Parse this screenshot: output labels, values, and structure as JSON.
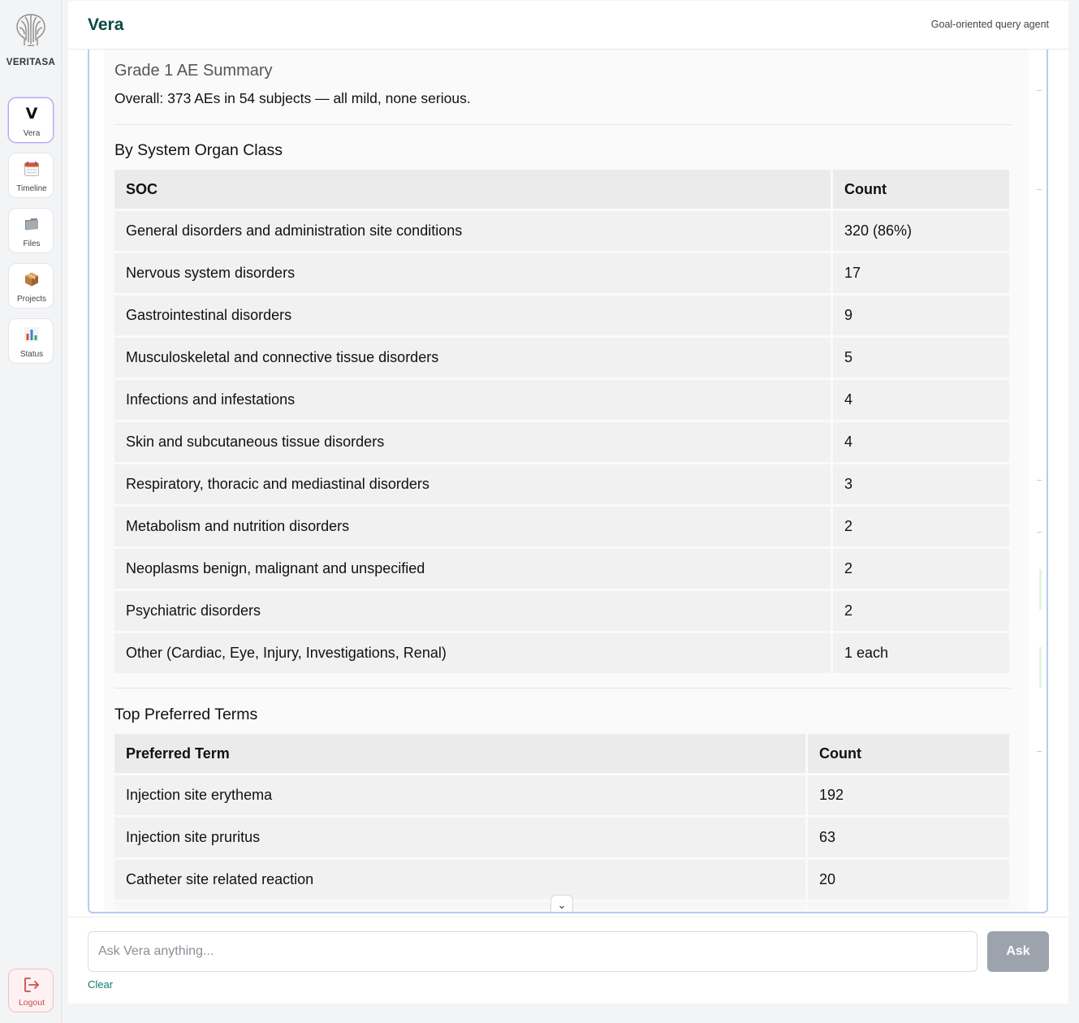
{
  "sidebar": {
    "brand": "VERITASA",
    "items": [
      {
        "label": "Vera",
        "icon": "v-letter-icon",
        "glyph": "V"
      },
      {
        "label": "Timeline",
        "icon": "calendar-icon"
      },
      {
        "label": "Files",
        "icon": "folder-icon"
      },
      {
        "label": "Projects",
        "icon": "package-icon"
      },
      {
        "label": "Status",
        "icon": "bar-chart-icon"
      }
    ],
    "logout_label": "Logout"
  },
  "header": {
    "title": "Vera",
    "subtitle": "Goal-oriented query agent"
  },
  "report": {
    "summary_title": "Grade 1 AE Summary",
    "summary_text": "Overall: 373 AEs in 54 subjects — all mild, none serious.",
    "soc_section": {
      "title": "By System Organ Class",
      "headers": [
        "SOC",
        "Count"
      ],
      "rows": [
        [
          "General disorders and administration site conditions",
          "320 (86%)"
        ],
        [
          "Nervous system disorders",
          "17"
        ],
        [
          "Gastrointestinal disorders",
          "9"
        ],
        [
          "Musculoskeletal and connective tissue disorders",
          "5"
        ],
        [
          "Infections and infestations",
          "4"
        ],
        [
          "Skin and subcutaneous tissue disorders",
          "4"
        ],
        [
          "Respiratory, thoracic and mediastinal disorders",
          "3"
        ],
        [
          "Metabolism and nutrition disorders",
          "2"
        ],
        [
          "Neoplasms benign, malignant and unspecified",
          "2"
        ],
        [
          "Psychiatric disorders",
          "2"
        ],
        [
          "Other (Cardiac, Eye, Injury, Investigations, Renal)",
          "1 each"
        ]
      ]
    },
    "pt_section": {
      "title": "Top Preferred Terms",
      "headers": [
        "Preferred Term",
        "Count"
      ],
      "rows": [
        [
          "Injection site erythema",
          "192"
        ],
        [
          "Injection site pruritus",
          "63"
        ],
        [
          "Catheter site related reaction",
          "20"
        ],
        [
          "",
          ""
        ]
      ]
    },
    "scroll_down_glyph": "⌄"
  },
  "input": {
    "placeholder": "Ask Vera anything...",
    "value": "",
    "ask_label": "Ask",
    "clear_label": "Clear"
  },
  "colors": {
    "brand_teal": "#0d4a43",
    "active_border": "#b9a6ee",
    "panel_border": "#b3cdf3",
    "ask_button": "#9ca3ad",
    "logout_red": "#d14b4b",
    "link_teal": "#0f7a6c"
  }
}
